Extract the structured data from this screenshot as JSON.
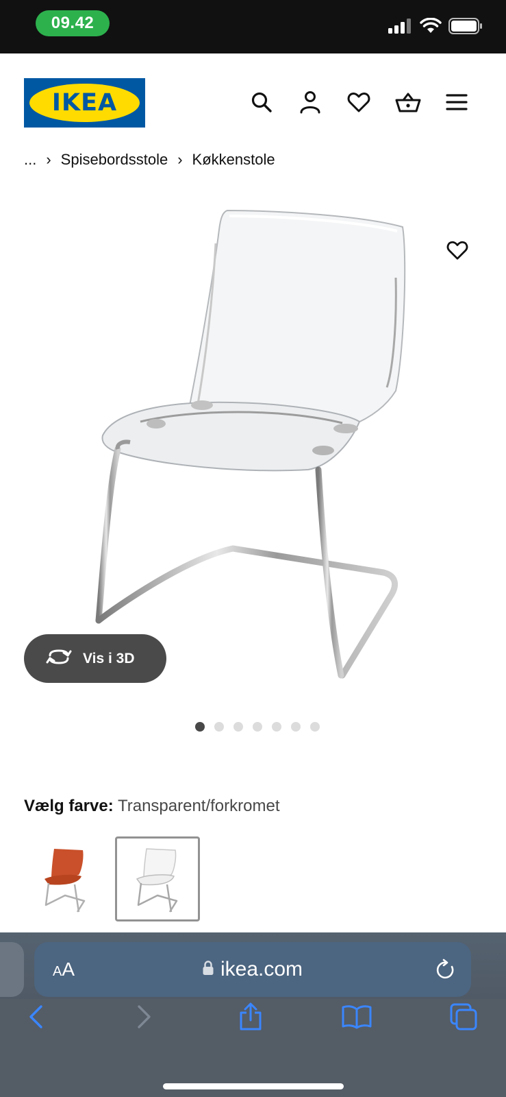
{
  "status_bar": {
    "time": "09.42"
  },
  "header": {
    "logo_text": "IKEA",
    "icons": [
      "search-icon",
      "account-icon",
      "heart-icon",
      "basket-icon",
      "menu-icon"
    ]
  },
  "breadcrumb": {
    "ellipsis": "...",
    "items": [
      "Spisebordsstole",
      "Køkkenstole"
    ]
  },
  "gallery": {
    "view_3d_label": "Vis i 3D",
    "image_count": 7,
    "active_index": 0
  },
  "color_select": {
    "label": "Vælg farve:",
    "value": "Transparent/forkromet",
    "options": [
      "Orange/forkromet",
      "Transparent/forkromet"
    ],
    "selected_index": 1
  },
  "browser": {
    "text_size_label_small": "A",
    "text_size_label_large": "A",
    "url": "ikea.com"
  },
  "colors": {
    "ikea_blue": "#0058a3",
    "ikea_yellow": "#ffdb00",
    "status_green": "#2db14d",
    "safari_blue": "#3a86ff"
  }
}
